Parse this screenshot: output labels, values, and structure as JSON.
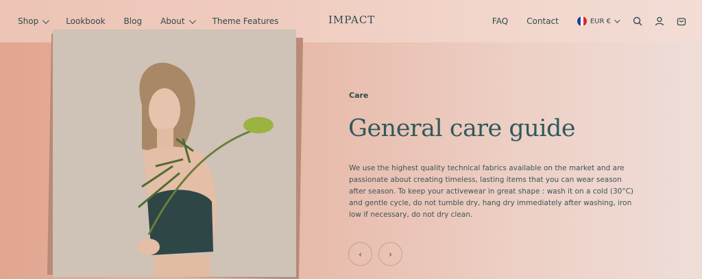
{
  "header": {
    "logo": "IMPACT",
    "left_nav": [
      {
        "label": "Shop"
      },
      {
        "label": "Lookbook"
      },
      {
        "label": "Blog"
      },
      {
        "label": "About"
      },
      {
        "label": "Theme Features"
      }
    ],
    "right_nav": [
      {
        "label": "FAQ"
      },
      {
        "label": "Contact"
      }
    ],
    "currency": "EUR €",
    "icons": [
      "search-icon",
      "account-icon",
      "cart-icon"
    ]
  },
  "slide": {
    "eyebrow": "Care",
    "title": "General care guide",
    "body": "We use the highest quality technical fabrics available on the market and are passionate about creating timeless, lasting items that you can wear season after season. To keep your activewear in great shape : wash it on a cold (30°C) and gentle cycle, do not tumble dry, hang dry immediately after washing, iron low if necessary, do not dry clean.",
    "prev": "‹",
    "next": "›"
  },
  "colors": {
    "text": "#2f4a4c",
    "title": "#2f5a5c",
    "background_left": "#e2a690",
    "background_right": "#efddd8"
  }
}
